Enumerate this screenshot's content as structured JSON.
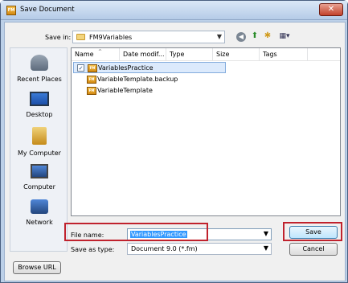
{
  "window": {
    "title": "Save Document",
    "app_icon_text": "FM",
    "close_glyph": "✕"
  },
  "toolbar": {
    "save_in_label": "Save in:",
    "save_in_value": "FM9Variables",
    "icons": [
      "back-icon",
      "up-folder-icon",
      "new-folder-icon",
      "views-icon"
    ]
  },
  "places": [
    {
      "label": "Recent Places",
      "icon": "recent-places-icon"
    },
    {
      "label": "Desktop",
      "icon": "desktop-icon"
    },
    {
      "label": "My Computer",
      "icon": "my-computer-icon"
    },
    {
      "label": "Computer",
      "icon": "computer-icon"
    },
    {
      "label": "Network",
      "icon": "network-icon"
    }
  ],
  "file_list": {
    "columns": [
      "Name",
      "Date modif...",
      "Type",
      "Size",
      "Tags"
    ],
    "files": [
      {
        "name": "VariablesPractice",
        "selected": true
      },
      {
        "name": "VariableTemplate.backup",
        "selected": false
      },
      {
        "name": "VariableTemplate",
        "selected": false
      }
    ]
  },
  "form": {
    "file_name_label": "File name:",
    "file_name_value": "VariablesPractice",
    "save_as_type_label": "Save as type:",
    "save_as_type_value": "Document 9.0 (*.fm)"
  },
  "buttons": {
    "save": "Save",
    "cancel": "Cancel",
    "browse_url": "Browse URL"
  },
  "colors": {
    "highlight_outline": "#c0222d",
    "selection_bg": "#3399ff"
  }
}
